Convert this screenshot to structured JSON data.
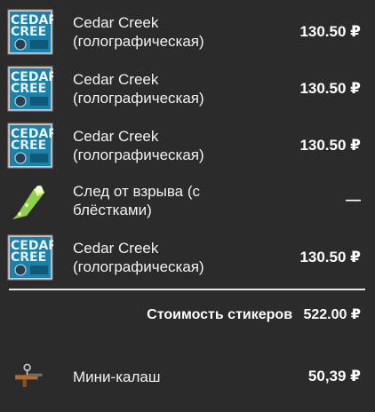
{
  "stickers": [
    {
      "name": "Cedar Creek\n(голографическая)",
      "price": "130.50 ₽",
      "icon": "cedar-creek-sticker-icon"
    },
    {
      "name": "Cedar Creek\n(голографическая)",
      "price": "130.50 ₽",
      "icon": "cedar-creek-sticker-icon"
    },
    {
      "name": "Cedar Creek\n(голографическая)",
      "price": "130.50 ₽",
      "icon": "cedar-creek-sticker-icon"
    },
    {
      "name": "След от взрыва (с\nблёстками)",
      "price": "—",
      "icon": "blast-trail-sticker-icon"
    },
    {
      "name": "Cedar Creek\n(голографическая)",
      "price": "130.50 ₽",
      "icon": "cedar-creek-sticker-icon"
    }
  ],
  "summary": {
    "label": "Стоимость стикеров",
    "value": "522.00 ₽"
  },
  "charm": {
    "name": "Мини-калаш",
    "price": "50,39 ₽",
    "icon": "mini-kalash-charm-icon"
  },
  "colors": {
    "background": "#2b2b2b",
    "divider": "#e8e8e8",
    "sticker_blue": "#1fa3c9"
  }
}
